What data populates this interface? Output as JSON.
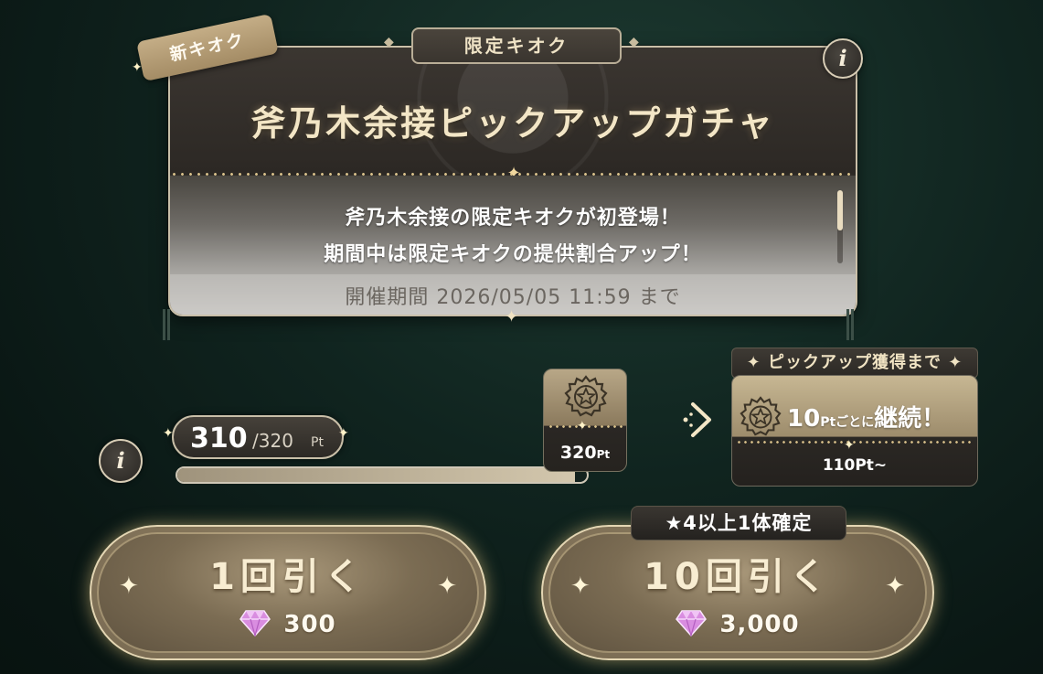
{
  "banner": {
    "new_badge": "新キオク",
    "tab_label": "限定キオク",
    "title": "斧乃木余接ピックアップガチャ",
    "desc_line1": "斧乃木余接の限定キオクが初登場！",
    "desc_line2": "期間中は限定キオクの提供割合アップ！",
    "period": "開催期間 2026/05/05 11:59 まで",
    "info_label": "i"
  },
  "progress": {
    "current": "310",
    "total": "/320",
    "unit": "Pt",
    "fill_fraction": 0.97,
    "info_label": "i",
    "milestone_value": "320",
    "milestone_unit": "Pt"
  },
  "pickup": {
    "header": "ピックアップ獲得まで",
    "value": "10",
    "unit_small": "Ptごとに",
    "continue_text": "継続！",
    "threshold": "110Pt~"
  },
  "gacha": {
    "single_label": "1回引く",
    "single_cost": "300",
    "ten_label": "10回引く",
    "ten_cost": "3,000",
    "guarantee": "★4以上1体確定"
  },
  "colors": {
    "accent_gold": "#e4d6b3",
    "background": "#10241f",
    "gem": "#d98de0"
  },
  "icons": [
    "star-badge-icon",
    "chevron-arrow-icon",
    "gem-icon",
    "sparkle-icon",
    "info-icon"
  ]
}
